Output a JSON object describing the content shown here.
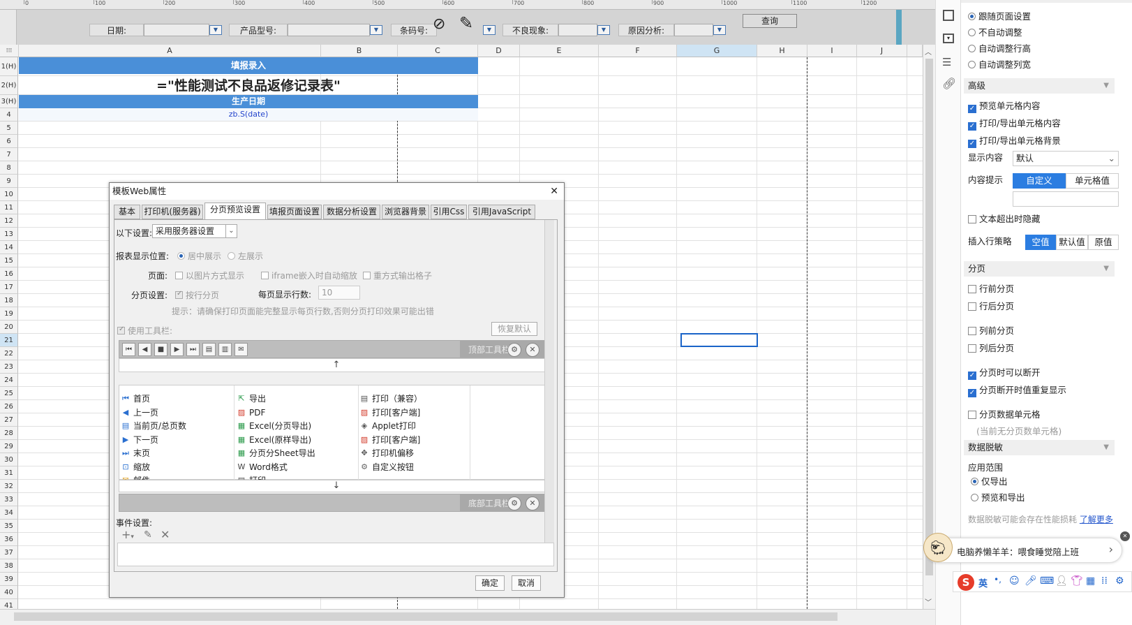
{
  "ruler": {
    "labels": [
      "0",
      "100",
      "200",
      "300",
      "400",
      "500",
      "600",
      "700",
      "800",
      "900",
      "1000",
      "1100",
      "1200"
    ]
  },
  "params": {
    "date_label": "日期:",
    "model_label": "产品型号:",
    "barcode_label": "条码号:",
    "defect_label": "不良现象:",
    "cause_label": "原因分析:",
    "query_button": "查询"
  },
  "sheet": {
    "columns": [
      "A",
      "B",
      "C",
      "D",
      "E",
      "F",
      "G",
      "H",
      "I",
      "J"
    ],
    "rows": [
      "1(H)",
      "2(H)",
      "3(H)",
      "4",
      "5",
      "6",
      "7",
      "8",
      "9",
      "10",
      "11",
      "12",
      "13",
      "14",
      "15",
      "16",
      "17",
      "18",
      "19",
      "20",
      "21",
      "22",
      "23",
      "24",
      "25",
      "26",
      "27",
      "28",
      "29",
      "30",
      "31",
      "32",
      "33",
      "34",
      "35",
      "36",
      "37",
      "38",
      "39",
      "40",
      "41"
    ],
    "r1": "填报录入",
    "r2": "=\"性能测试不良品返修记录表\"",
    "r3": "生产日期",
    "r4": "zb.S(date)"
  },
  "dialog": {
    "title": "模板Web属性",
    "close": "✕",
    "tabs": [
      "基本",
      "打印机(服务器)",
      "分页预览设置",
      "填报页面设置",
      "数据分析设置",
      "浏览器背景",
      "引用Css",
      "引用JavaScript"
    ],
    "setting_label": "以下设置:",
    "setting_value": "采用服务器设置",
    "position_label": "报表显示位置:",
    "position_center": "居中展示",
    "position_left": "左展示",
    "page_label": "页面:",
    "page_opt1": "以图片方式显示",
    "page_opt2": "iframe嵌入时自动缩放",
    "page_opt3": "重方式输出格子",
    "paging_label": "分页设置:",
    "paging_opt": "按行分页",
    "rows_per_page_label": "每页显示行数:",
    "rows_per_page_value": "10",
    "hint": "提示：请确保打印页面能完整显示每页行数,否则分页打印效果可能出错",
    "use_toolbar": "使用工具栏:",
    "restore_default": "恢复默认",
    "top_toolbar": "顶部工具栏",
    "bottom_toolbar": "底部工具栏",
    "col1": [
      "首页",
      "上一页",
      "当前页/总页数",
      "下一页",
      "末页",
      "缩放",
      "邮件"
    ],
    "col2": [
      "导出",
      "PDF",
      "Excel(分页导出)",
      "Excel(原样导出)",
      "分页分Sheet导出",
      "Word格式",
      "打印"
    ],
    "col3": [
      "打印（兼容）",
      "打印[客户端]",
      "Applet打印",
      "打印[客户端]",
      "打印机偏移",
      "自定义按钮"
    ],
    "event_label": "事件设置:",
    "ok": "确定",
    "cancel": "取消"
  },
  "right_panel": {
    "radios1": [
      "跟随页面设置",
      "不自动调整",
      "自动调整行高",
      "自动调整列宽"
    ],
    "section_advanced": "高级",
    "adv_checks": [
      "预览单元格内容",
      "打印/导出单元格内容",
      "打印/导出单元格背景"
    ],
    "display_content_label": "显示内容",
    "display_content_value": "默认",
    "content_tip_label": "内容提示",
    "content_tip_custom": "自定义",
    "content_tip_cell": "单元格值",
    "text_overflow_hide": "文本超出时隐藏",
    "insert_policy_label": "插入行策略",
    "insert_empty": "空值",
    "insert_default": "默认值",
    "insert_original": "原值",
    "section_paging": "分页",
    "paging_checks": [
      "行前分页",
      "行后分页",
      "列前分页",
      "列后分页",
      "分页时可以断开",
      "分页断开时值重复显示",
      "分页数据单元格"
    ],
    "no_paging_cell": "(当前无分页数单元格)",
    "section_mask": "数据脱敏",
    "apply_scope_label": "应用范围",
    "scope_export": "仅导出",
    "scope_preview_export": "预览和导出",
    "mask_hint": "数据脱敏可能会存在性能损耗",
    "learn_more": "了解更多"
  },
  "notification": {
    "text": "电脑养懒羊羊：喂食睡觉陪上班",
    "close": "✕",
    "arrow": "›"
  },
  "ime": {
    "lang": "英",
    "punct": "•,"
  }
}
